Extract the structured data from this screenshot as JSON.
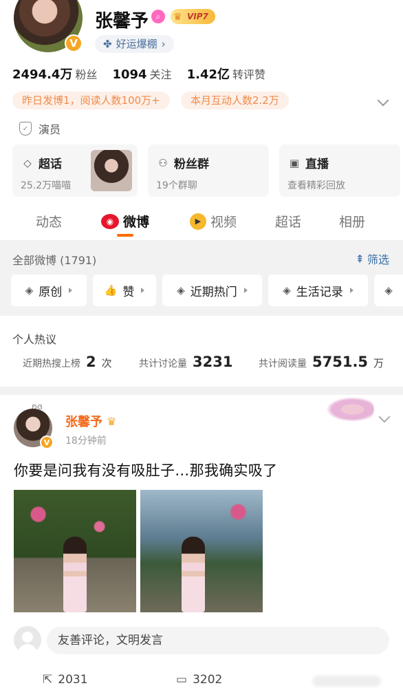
{
  "profile": {
    "name": "张馨予",
    "vip_label": "VIP7",
    "luck_pill": "好运爆棚",
    "verified_mark": "V",
    "role": "演员"
  },
  "stats": [
    {
      "num": "2494.4万",
      "label": "粉丝"
    },
    {
      "num": "1094",
      "label": "关注"
    },
    {
      "num": "1.42亿",
      "label": "转评赞"
    }
  ],
  "tags": [
    "昨日发博1，阅读人数100万+",
    "本月互动人数2.2万"
  ],
  "cards": [
    {
      "title": "超话",
      "sub": "25.2万喵喵",
      "icon": "diamond-icon"
    },
    {
      "title": "粉丝群",
      "sub": "19个群聊",
      "icon": "group-icon"
    },
    {
      "title": "直播",
      "sub": "查看精彩回放",
      "icon": "tv-icon"
    }
  ],
  "tabs": [
    "动态",
    "微博",
    "视频",
    "超话",
    "相册"
  ],
  "active_tab": "微博",
  "filter": {
    "all_label": "全部微博 (1791)",
    "filter_label": "筛选",
    "chips": [
      "原创",
      "赞",
      "近期热门",
      "生活记录"
    ]
  },
  "hot": {
    "title": "个人热议",
    "items": [
      {
        "label": "近期热搜上榜",
        "value": "2",
        "unit": "次"
      },
      {
        "label": "共计讨论量",
        "value": "3231",
        "unit": ""
      },
      {
        "label": "共计阅读量",
        "value": "5751.5",
        "unit": "万"
      }
    ]
  },
  "post": {
    "author": "张馨予",
    "time": "18分钟前",
    "text": "你要是问我有没有吸肚子…那我确实吸了",
    "comment_placeholder": "友善评论，文明发言",
    "reposts": "2031",
    "comments": "3202"
  },
  "colors": {
    "accent": "#ff6a00",
    "name_orange": "#f36b1d",
    "link_blue": "#3a6ea5",
    "tag_bg": "#fdf0e8"
  }
}
